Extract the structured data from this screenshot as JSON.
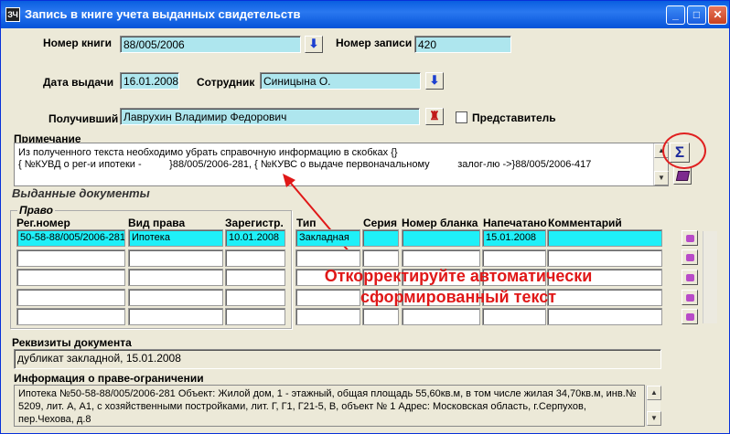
{
  "window": {
    "title": "Запись в книге учета выданных свидетельств",
    "icon_text": "ЗЧ",
    "btn_min": "_",
    "btn_max": "□",
    "btn_close": "✕"
  },
  "form": {
    "book_no_label": "Номер книги",
    "book_no_value": "88/005/2006",
    "record_no_label": "Номер записи",
    "record_no_value": "420",
    "issue_date_label": "Дата выдачи",
    "issue_date_value": "16.01.2008",
    "employee_label": "Сотрудник",
    "employee_value": "Синицына О.",
    "recipient_label": "Получивший",
    "recipient_value": "Лаврухин Владимир Федорович",
    "representative_label": "Представитель",
    "dropdown_glyph": "⬇",
    "recipient_glyph": "♜"
  },
  "note": {
    "label": "Примечание",
    "line1": "Из полученного текста необходимо убрать справочную информацию в скобках {}",
    "line2": "{ №КУВД о рег-и ипотеки -          }88/005/2006-281, { №КУВС о выдаче первоначальному          залог-лю ->}88/005/2006-417",
    "sigma": "Σ"
  },
  "issued_docs": {
    "title": "Выданные документы",
    "group_label": "Право",
    "headers": {
      "reg_no": "Рег.номер",
      "right_type": "Вид права",
      "registered": "Зарегистр.",
      "type": "Тип",
      "series": "Серия",
      "blank_no": "Номер бланка",
      "printed": "Напечатано",
      "comment": "Комментарий"
    },
    "rows": [
      {
        "reg_no": "50-58-88/005/2006-281",
        "right_type": "Ипотека",
        "registered": "10.01.2008",
        "type": "Закладная",
        "series": "",
        "blank_no": "",
        "printed": "15.01.2008",
        "comment": ""
      },
      {
        "reg_no": "",
        "right_type": "",
        "registered": "",
        "type": "",
        "series": "",
        "blank_no": "",
        "printed": "",
        "comment": ""
      },
      {
        "reg_no": "",
        "right_type": "",
        "registered": "",
        "type": "",
        "series": "",
        "blank_no": "",
        "printed": "",
        "comment": ""
      },
      {
        "reg_no": "",
        "right_type": "",
        "registered": "",
        "type": "",
        "series": "",
        "blank_no": "",
        "printed": "",
        "comment": ""
      },
      {
        "reg_no": "",
        "right_type": "",
        "registered": "",
        "type": "",
        "series": "",
        "blank_no": "",
        "printed": "",
        "comment": ""
      }
    ]
  },
  "callout": {
    "line1": "Откорректируйте автоматически",
    "line2": "сформированный текст"
  },
  "doc_details": {
    "label": "Реквизиты документа",
    "value": "дубликат закладной,  15.01.2008"
  },
  "right_info": {
    "label": "Информация о праве-ограничении",
    "text": "Ипотека №50-58-88/005/2006-281 Объект: Жилой дом, 1 - этажный, общая площадь 55,60кв.м, в том числе жилая 34,70кв.м, инв.№ 5209, лит. А, А1, с хозяйственными постройками, лит. Г, Г1, Г21-5, В, объект № 1 Адрес: Московская область, г.Серпухов, пер.Чехова, д.8"
  },
  "colors": {
    "title_bar": "#0a5ee0",
    "field_cyan": "#aee6ee",
    "selected_row": "#1ff0f8",
    "callout_red": "#e01818"
  }
}
